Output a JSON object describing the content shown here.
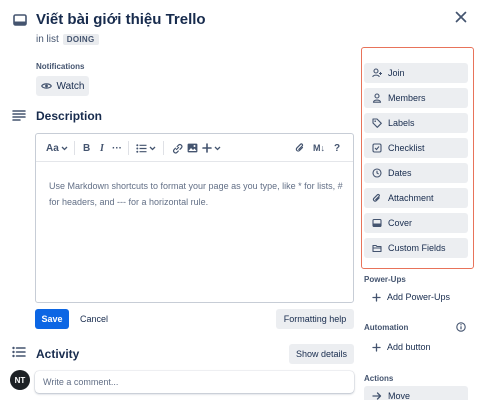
{
  "header": {
    "title": "Viết bài giới thiệu Trello",
    "list_prefix": "in list",
    "list_name": "DOING"
  },
  "notifications": {
    "label": "Notifications",
    "watch_label": "Watch"
  },
  "description": {
    "heading": "Description",
    "toolbar": {
      "text_style": "Aa",
      "bold": "B",
      "italic": "I",
      "more": "···",
      "markdown": "M↓",
      "help": "?"
    },
    "placeholder": "Use Markdown shortcuts to format your page as you type, like * for lists, # for headers, and --- for a horizontal rule.",
    "save_label": "Save",
    "cancel_label": "Cancel",
    "formatting_help_label": "Formatting help"
  },
  "activity": {
    "heading": "Activity",
    "show_details_label": "Show details",
    "avatar_initials": "NT",
    "comment_placeholder": "Write a comment..."
  },
  "sidebar": {
    "add_to_card": [
      {
        "label": "Join",
        "icon": "user-plus-icon"
      },
      {
        "label": "Members",
        "icon": "user-icon"
      },
      {
        "label": "Labels",
        "icon": "tag-icon"
      },
      {
        "label": "Checklist",
        "icon": "checkbox-icon"
      },
      {
        "label": "Dates",
        "icon": "clock-icon"
      },
      {
        "label": "Attachment",
        "icon": "paperclip-icon"
      },
      {
        "label": "Cover",
        "icon": "cover-icon"
      },
      {
        "label": "Custom Fields",
        "icon": "folder-icon"
      }
    ],
    "power_ups_label": "Power-Ups",
    "add_power_ups_label": "Add Power-Ups",
    "automation_label": "Automation",
    "add_button_label": "Add button",
    "actions_label": "Actions",
    "move_label": "Move"
  },
  "colors": {
    "primary": "#0c66e4",
    "highlight": "#e8735a",
    "button_bg": "#eceef1",
    "text": "#172b4d"
  }
}
